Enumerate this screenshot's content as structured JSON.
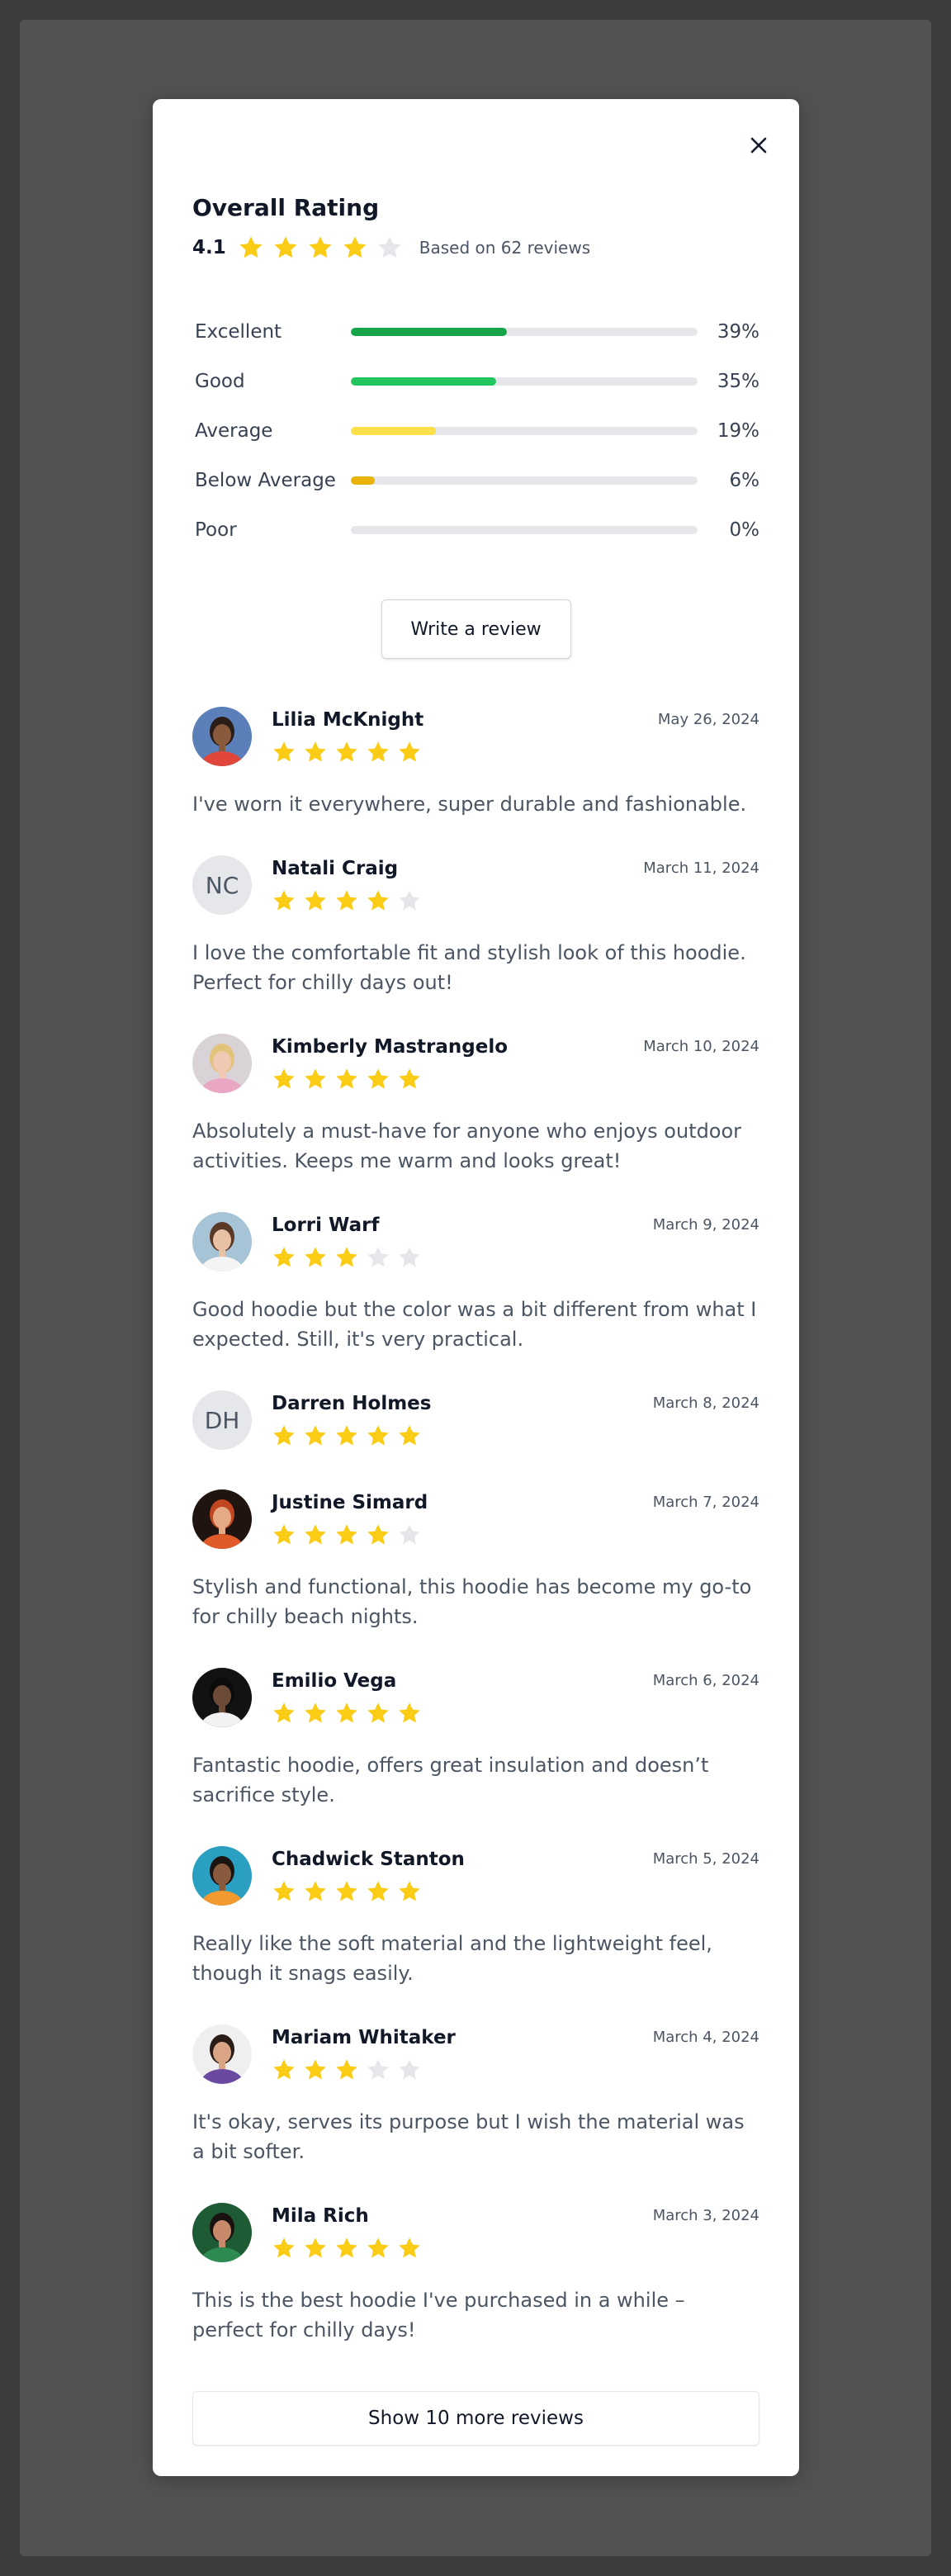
{
  "colors": {
    "star_filled": "#facc15",
    "star_empty": "#e5e7eb",
    "bar_excellent": "#16a34a",
    "bar_good": "#22c55e",
    "bar_average": "#fde047",
    "bar_below_average": "#eab308",
    "bar_poor": "#e5e7eb"
  },
  "summary": {
    "title": "Overall Rating",
    "average": "4.1",
    "average_stars": 4,
    "based_on": "Based on 62 reviews"
  },
  "distribution": [
    {
      "label": "Excellent",
      "percent_text": "39%",
      "percent": 0.45,
      "color": "#16a34a"
    },
    {
      "label": "Good",
      "percent_text": "35%",
      "percent": 0.42,
      "color": "#22c55e"
    },
    {
      "label": "Average",
      "percent_text": "19%",
      "percent": 0.245,
      "color": "#fde047"
    },
    {
      "label": "Below Average",
      "percent_text": "6%",
      "percent": 0.07,
      "color": "#eab308"
    },
    {
      "label": "Poor",
      "percent_text": "0%",
      "percent": 0,
      "color": "#e5e7eb"
    }
  ],
  "actions": {
    "write_review": "Write a review",
    "show_more": "Show 10 more reviews",
    "close_icon": "close-icon"
  },
  "reviews": [
    {
      "name": "Lilia McKnight",
      "date": "May 26, 2024",
      "rating": 5,
      "text": "I've worn it everywhere, super durable and fashionable.",
      "avatar": "photo-orange",
      "initials": ""
    },
    {
      "name": "Natali Craig",
      "date": "March 11, 2024",
      "rating": 4,
      "text": "I love the comfortable fit and stylish look of this hoodie. Perfect for chilly days out!",
      "avatar": "initials",
      "initials": "NC"
    },
    {
      "name": "Kimberly Mastrangelo",
      "date": "March 10, 2024",
      "rating": 5,
      "text": "Absolutely a must-have for anyone who enjoys outdoor activities. Keeps me warm and looks great!",
      "avatar": "photo-blonde",
      "initials": ""
    },
    {
      "name": "Lorri Warf",
      "date": "March 9, 2024",
      "rating": 3,
      "text": "Good hoodie but the color was a bit different from what I expected. Still, it's very practical.",
      "avatar": "photo-brunette",
      "initials": ""
    },
    {
      "name": "Darren Holmes",
      "date": "March 8, 2024",
      "rating": 5,
      "text": "",
      "avatar": "initials",
      "initials": "DH"
    },
    {
      "name": "Justine Simard",
      "date": "March 7, 2024",
      "rating": 4,
      "text": "Stylish and functional, this hoodie has become my go-to for chilly beach nights.",
      "avatar": "photo-redhead",
      "initials": ""
    },
    {
      "name": "Emilio Vega",
      "date": "March 6, 2024",
      "rating": 5,
      "text": "Fantastic hoodie, offers great insulation and doesn’t sacrifice style.",
      "avatar": "photo-dark",
      "initials": ""
    },
    {
      "name": "Chadwick Stanton",
      "date": "March 5, 2024",
      "rating": 5,
      "text": "Really like the soft material and the lightweight feel, though it snags easily.",
      "avatar": "photo-teal",
      "initials": ""
    },
    {
      "name": "Mariam Whitaker",
      "date": "March 4, 2024",
      "rating": 3,
      "text": "It's okay, serves its purpose but I wish the material was a bit softer.",
      "avatar": "photo-glasses",
      "initials": ""
    },
    {
      "name": "Mila Rich",
      "date": "March 3, 2024",
      "rating": 5,
      "text": "This is the best hoodie I've purchased in a while – perfect for chilly days!",
      "avatar": "photo-green",
      "initials": ""
    }
  ]
}
